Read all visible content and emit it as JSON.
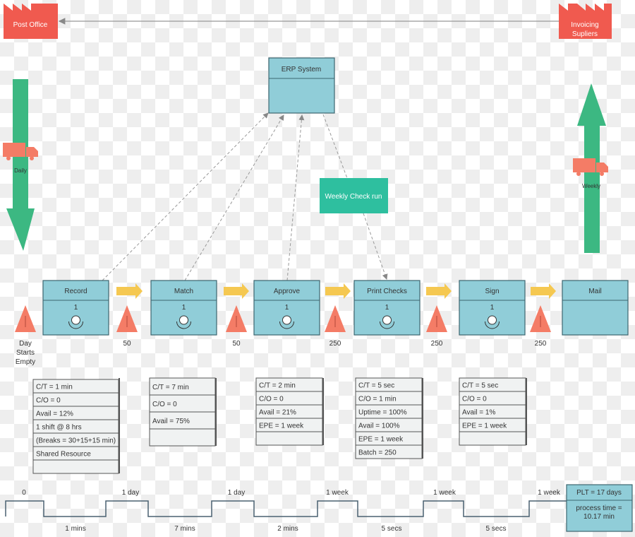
{
  "colors": {
    "process": "#90cdd8",
    "inventory": "#f47c66",
    "push": "#f5c851",
    "flow": "#3cb882",
    "supplier": "#f05a4f",
    "kanban": "#2ebf9f"
  },
  "external": {
    "left": "Post Office",
    "right": [
      "Invoicing",
      "Supliers"
    ]
  },
  "erp": {
    "label": "ERP System"
  },
  "weekly_check": "Weekly Check run",
  "left_transport": "Daily",
  "right_transport": "Weekly",
  "processes": [
    {
      "name": "Record",
      "operators": "1"
    },
    {
      "name": "Match",
      "operators": "1"
    },
    {
      "name": "Approve",
      "operators": "1"
    },
    {
      "name": "Print Checks",
      "operators": "1"
    },
    {
      "name": "Sign",
      "operators": "1"
    },
    {
      "name": "Mail",
      "operators": ""
    }
  ],
  "inventory": [
    [
      "Day",
      "Starts",
      "Empty"
    ],
    [
      "50"
    ],
    [
      "50"
    ],
    [
      "250"
    ],
    [
      "250"
    ],
    [
      "250"
    ]
  ],
  "data_boxes": [
    [
      "C/T = 1 min",
      "C/O = 0",
      "Avail = 12%",
      "1 shift @ 8 hrs",
      "(Breaks = 30+15+15 min)",
      "Shared Resource",
      ""
    ],
    [
      "C/T = 7 min",
      "C/O = 0",
      "Avail = 75%",
      ""
    ],
    [
      "C/T = 2 min",
      "C/O = 0",
      "Avail = 21%",
      "EPE = 1 week",
      ""
    ],
    [
      "C/T = 5 sec",
      "C/O = 1 min",
      "Uptime = 100%",
      "Avail = 100%",
      "EPE = 1 week",
      "Batch = 250"
    ],
    [
      "C/T = 5 sec",
      "C/O = 0",
      "Avail = 1%",
      "EPE = 1 week",
      ""
    ]
  ],
  "timeline": {
    "waits": [
      "0",
      "1 day",
      "1 day",
      "1 week",
      "1 week",
      "1 week"
    ],
    "processes": [
      "1 mins",
      "7 mins",
      "2 mins",
      "5 secs",
      "5 secs"
    ],
    "plt": "PLT = 17 days",
    "process_time": [
      "process time =",
      "10.17 min"
    ]
  }
}
